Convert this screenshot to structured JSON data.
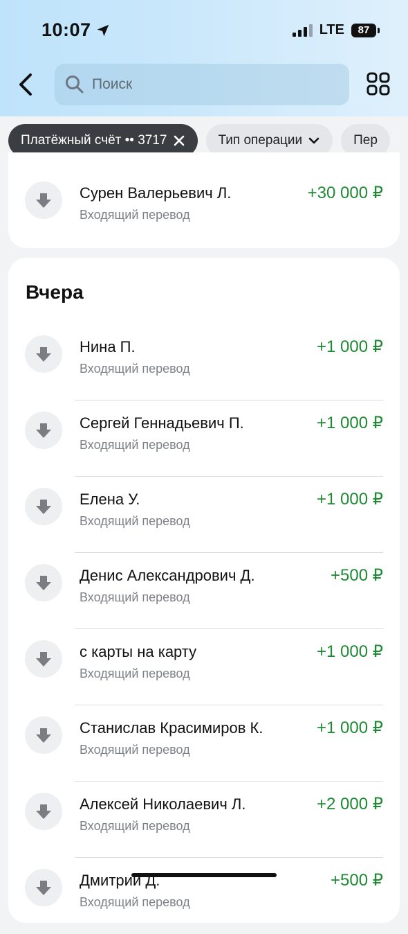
{
  "status_bar": {
    "time": "10:07",
    "network": "LTE",
    "battery": "87"
  },
  "header": {
    "search_placeholder": "Поиск"
  },
  "filters": [
    {
      "label": "Платёжный счёт •• 3717"
    },
    {
      "label": "Тип операции"
    },
    {
      "label": "Пер"
    }
  ],
  "top_operation": {
    "name": "Сурен Валерьевич Л.",
    "type": "Входящий перевод",
    "amount": "+30 000 ₽"
  },
  "section": {
    "title": "Вчера",
    "operations": [
      {
        "name": "Нина П.",
        "type": "Входящий перевод",
        "amount": "+1 000 ₽"
      },
      {
        "name": "Сергей Геннадьевич П.",
        "type": "Входящий перевод",
        "amount": "+1 000 ₽"
      },
      {
        "name": "Елена У.",
        "type": "Входящий перевод",
        "amount": "+1 000 ₽"
      },
      {
        "name": "Денис Александрович Д.",
        "type": "Входящий перевод",
        "amount": "+500 ₽"
      },
      {
        "name": "с карты на карту",
        "type": "Входящий перевод",
        "amount": "+1 000 ₽"
      },
      {
        "name": "Станислав Красимиров К.",
        "type": "Входящий перевод",
        "amount": "+1 000 ₽"
      },
      {
        "name": "Алексей Николаевич Л.",
        "type": "Входящий перевод",
        "amount": "+2 000 ₽"
      },
      {
        "name": "Дмитрий Д.",
        "type": "Входящий перевод",
        "amount": "+500 ₽"
      }
    ]
  },
  "icons": {
    "back": "chevron-left-icon",
    "search": "search-icon",
    "grid": "grid-icon",
    "close": "close-icon",
    "chevron": "chevron-down-icon",
    "incoming": "arrow-down-icon"
  },
  "colors": {
    "amount_positive": "#1f8a33",
    "active_chip": "#3a3d42"
  }
}
